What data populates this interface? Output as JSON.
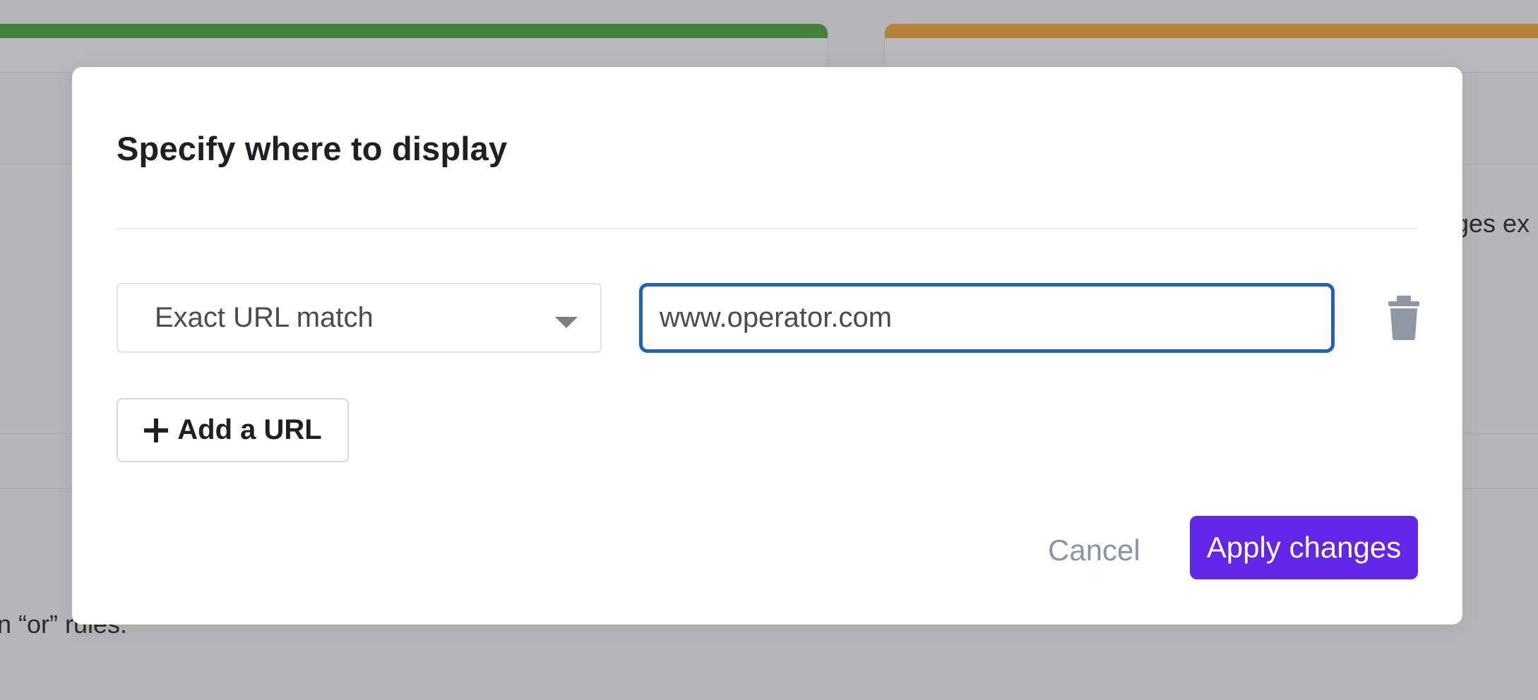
{
  "background": {
    "right_fragment": "ges ex",
    "left_fragment": "n “or” rules."
  },
  "modal": {
    "title": "Specify where to display",
    "rule": {
      "match_type": "Exact URL match",
      "url_value": "www.operator.com"
    },
    "add_url_label": "Add a URL",
    "cancel_label": "Cancel",
    "apply_label": "Apply changes"
  },
  "colors": {
    "primary_button": "#6126e8",
    "input_focus_border": "#1a62c4",
    "card_bar_green": "#44813b",
    "card_bar_orange": "#b68237"
  },
  "icons": {
    "delete": "trash-icon",
    "add": "plus-icon",
    "select": "caret-down-icon"
  }
}
